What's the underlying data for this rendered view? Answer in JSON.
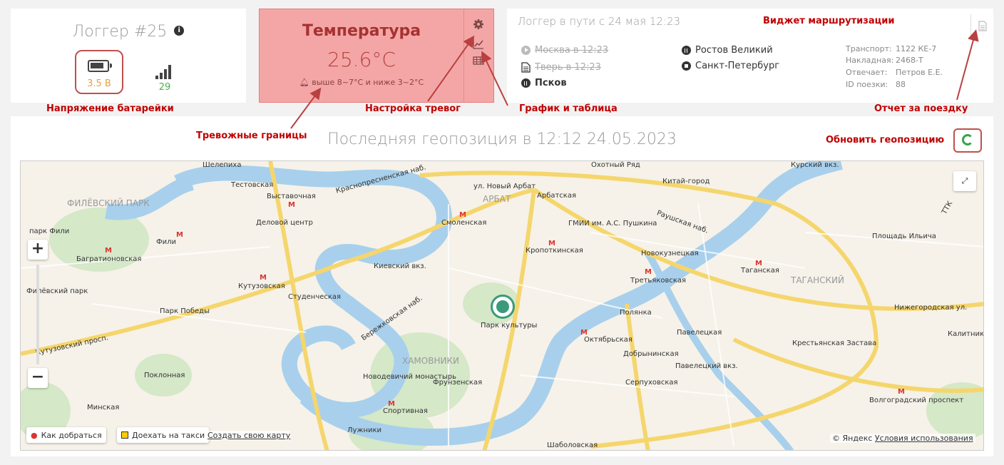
{
  "logger": {
    "title": "Логгер #25",
    "info_glyph": "i",
    "battery_value": "3.5 В",
    "signal_value": "29"
  },
  "temperature": {
    "title": "Температура",
    "value": "25.6°C",
    "limits": "выше 8~7°C и ниже 3~2°C"
  },
  "route": {
    "header": "Логгер в пути с 24 мая 12:23",
    "stops": [
      {
        "label": "Москва в 12:23",
        "state": "done"
      },
      {
        "label": "Тверь в 12:23",
        "state": "done"
      },
      {
        "label": "Псков",
        "state": "current"
      },
      {
        "label": "Ростов Великий",
        "state": "pending"
      },
      {
        "label": "Санкт-Петербург",
        "state": "pending"
      }
    ],
    "meta": [
      {
        "key": "Транспорт:",
        "value": "1122 КЕ-7"
      },
      {
        "key": "Накладная:",
        "value": "2468-Т"
      },
      {
        "key": "Отвечает:",
        "value": "Петров Е.Е."
      },
      {
        "key": "ID поезки:",
        "value": "88"
      }
    ]
  },
  "annotations": {
    "battery": "Напряжение батарейки",
    "alarm_settings": "Настройка тревог",
    "chart_table": "График и таблица",
    "routing_widget": "Виджет маршрутизации",
    "trip_report": "Отчет за поездку",
    "alarm_limits": "Тревожные границы",
    "refresh_geo": "Обновить геопозицию"
  },
  "map": {
    "title": "Последняя геопозиция в 12:12 24.05.2023",
    "district_labels": [
      "ФИЛЁВСКИЙ ПАРК",
      "АРБАТ",
      "ХАМОВНИКИ",
      "ТАГАНСКИЙ"
    ],
    "places": [
      "Шелепиха",
      "Тестовская",
      "Выставочная",
      "Деловой центр",
      "парк Фили",
      "Фили",
      "Багратионовская",
      "Филёвский парк",
      "Кутузовская",
      "Студенческая",
      "Парк Победы",
      "Поклонная",
      "Минская",
      "Киевский вкз.",
      "Смоленская",
      "ул. Новый Арбат",
      "Арбатская",
      "ГМИИ им. А.С. Пушкина",
      "Кропоткинская",
      "Парк культуры",
      "Новодевичий монастырь",
      "Фрунзенская",
      "Спортивная",
      "Лужники",
      "Шаболовская",
      "Октябрьская",
      "Полянка",
      "Третьяковская",
      "Новокузнецкая",
      "Павелецкая",
      "Павелецкий вкз.",
      "Добрынинская",
      "Серпуховская",
      "Таганская",
      "Крестьянская Застава",
      "Волгоградский проспект",
      "Площадь Ильича",
      "Нижегородская ул.",
      "Китай-город",
      "Курский вкз.",
      "Охотный Ряд",
      "Калитники",
      "Кутузовский просп.",
      "Бережковская наб.",
      "Краснопресненская наб.",
      "Раушская наб.",
      "ТТК"
    ],
    "controls": {
      "route_btn": "Как добраться",
      "taxi_btn": "Доехать на такси",
      "create_map": "Создать свою карту",
      "copyright": "© Яндекс",
      "terms": "Условия использования",
      "zoom_in": "+",
      "zoom_out": "−"
    }
  },
  "colors": {
    "alarm_bg": "#f4a6a6",
    "alarm_text": "#a63232",
    "annotation": "#c00000",
    "battery_value": "#e8a13a",
    "signal_value": "#4caf50",
    "refresh_icon": "#3aa350",
    "marker": "#3a9a7a"
  }
}
